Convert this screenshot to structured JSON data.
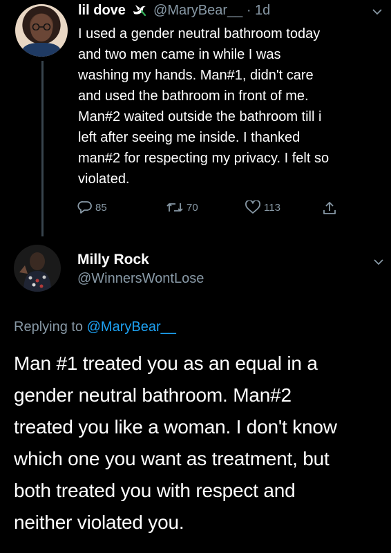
{
  "tweet": {
    "author": {
      "display_name": "lil dove",
      "handle": "@MaryBear__",
      "timestamp": "· 1d",
      "avatar_icon": "user-avatar-photo",
      "name_badge_icon": "dove-icon"
    },
    "text": "I used a gender neutral bathroom today\nand two men came in while I was\nwashing my hands. Man#1, didn't care\nand used the bathroom in front of me.\nMan#2 waited outside the bathroom till i\nleft after seeing me inside. I thanked\nman#2 for respecting my privacy. I felt so\nviolated.",
    "actions": {
      "reply_count": "85",
      "retweet_count": "70",
      "like_count": "113",
      "share_icon": "share-icon"
    }
  },
  "reply": {
    "author": {
      "display_name": "Milly Rock",
      "handle": "@WinnersWontLose",
      "avatar_icon": "user-avatar-photo"
    },
    "replying_prefix": "Replying to",
    "replying_to": "@MaryBear__",
    "text": "Man #1 treated you as an equal in a\ngender neutral bathroom. Man#2\ntreated you like a woman. I don't know\nwhich one you want as treatment, but\nboth treated you with respect and\nneither violated you."
  },
  "colors": {
    "background": "#000000",
    "text": "#ffffff",
    "muted": "#8899a6",
    "link": "#1da1f2",
    "thread_line": "#38444d"
  }
}
